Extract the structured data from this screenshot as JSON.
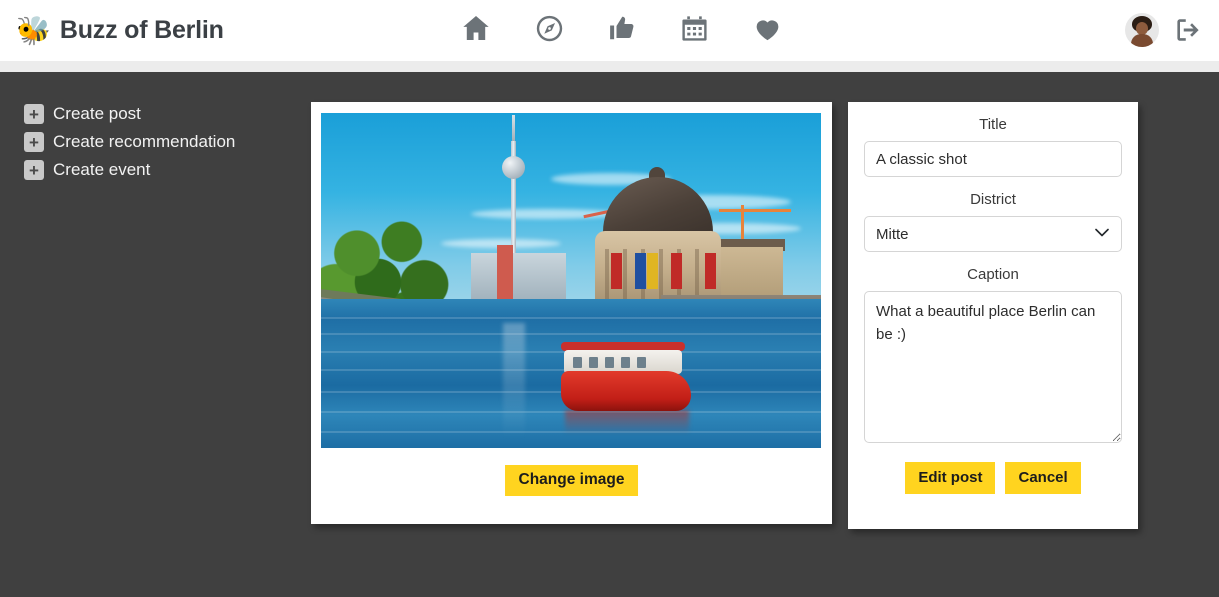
{
  "brand": {
    "logo_icon": "bee-icon",
    "logo_glyph": "🐝",
    "title": "Buzz of Berlin"
  },
  "nav": {
    "items": [
      {
        "icon": "home-icon",
        "label": "Home"
      },
      {
        "icon": "compass-icon",
        "label": "Explore"
      },
      {
        "icon": "thumbs-up-icon",
        "label": "Recommendations"
      },
      {
        "icon": "calendar-icon",
        "label": "Events"
      },
      {
        "icon": "heart-icon",
        "label": "Favourites"
      }
    ]
  },
  "header_right": {
    "avatar_icon": "avatar",
    "logout_icon": "logout-icon"
  },
  "sidebar": {
    "items": [
      {
        "plus": "+",
        "label": "Create post"
      },
      {
        "plus": "+",
        "label": "Create recommendation"
      },
      {
        "plus": "+",
        "label": "Create event"
      }
    ]
  },
  "image_card": {
    "image_alt": "Bode Museum on Museum Island with the Berlin TV Tower and a red tour boat on the Spree",
    "change_image_label": "Change image"
  },
  "form": {
    "title_label": "Title",
    "title_value": "A classic shot",
    "title_placeholder": "Title",
    "district_label": "District",
    "district_value": "Mitte",
    "district_options": [
      "Mitte"
    ],
    "caption_label": "Caption",
    "caption_value": "What a beautiful place Berlin can be :)",
    "caption_placeholder": "Caption",
    "submit_label": "Edit post",
    "cancel_label": "Cancel"
  },
  "colors": {
    "accent_yellow": "#FFD41F",
    "page_background": "#404040",
    "header_background": "#ffffff",
    "icon_gray": "#6c7378"
  }
}
